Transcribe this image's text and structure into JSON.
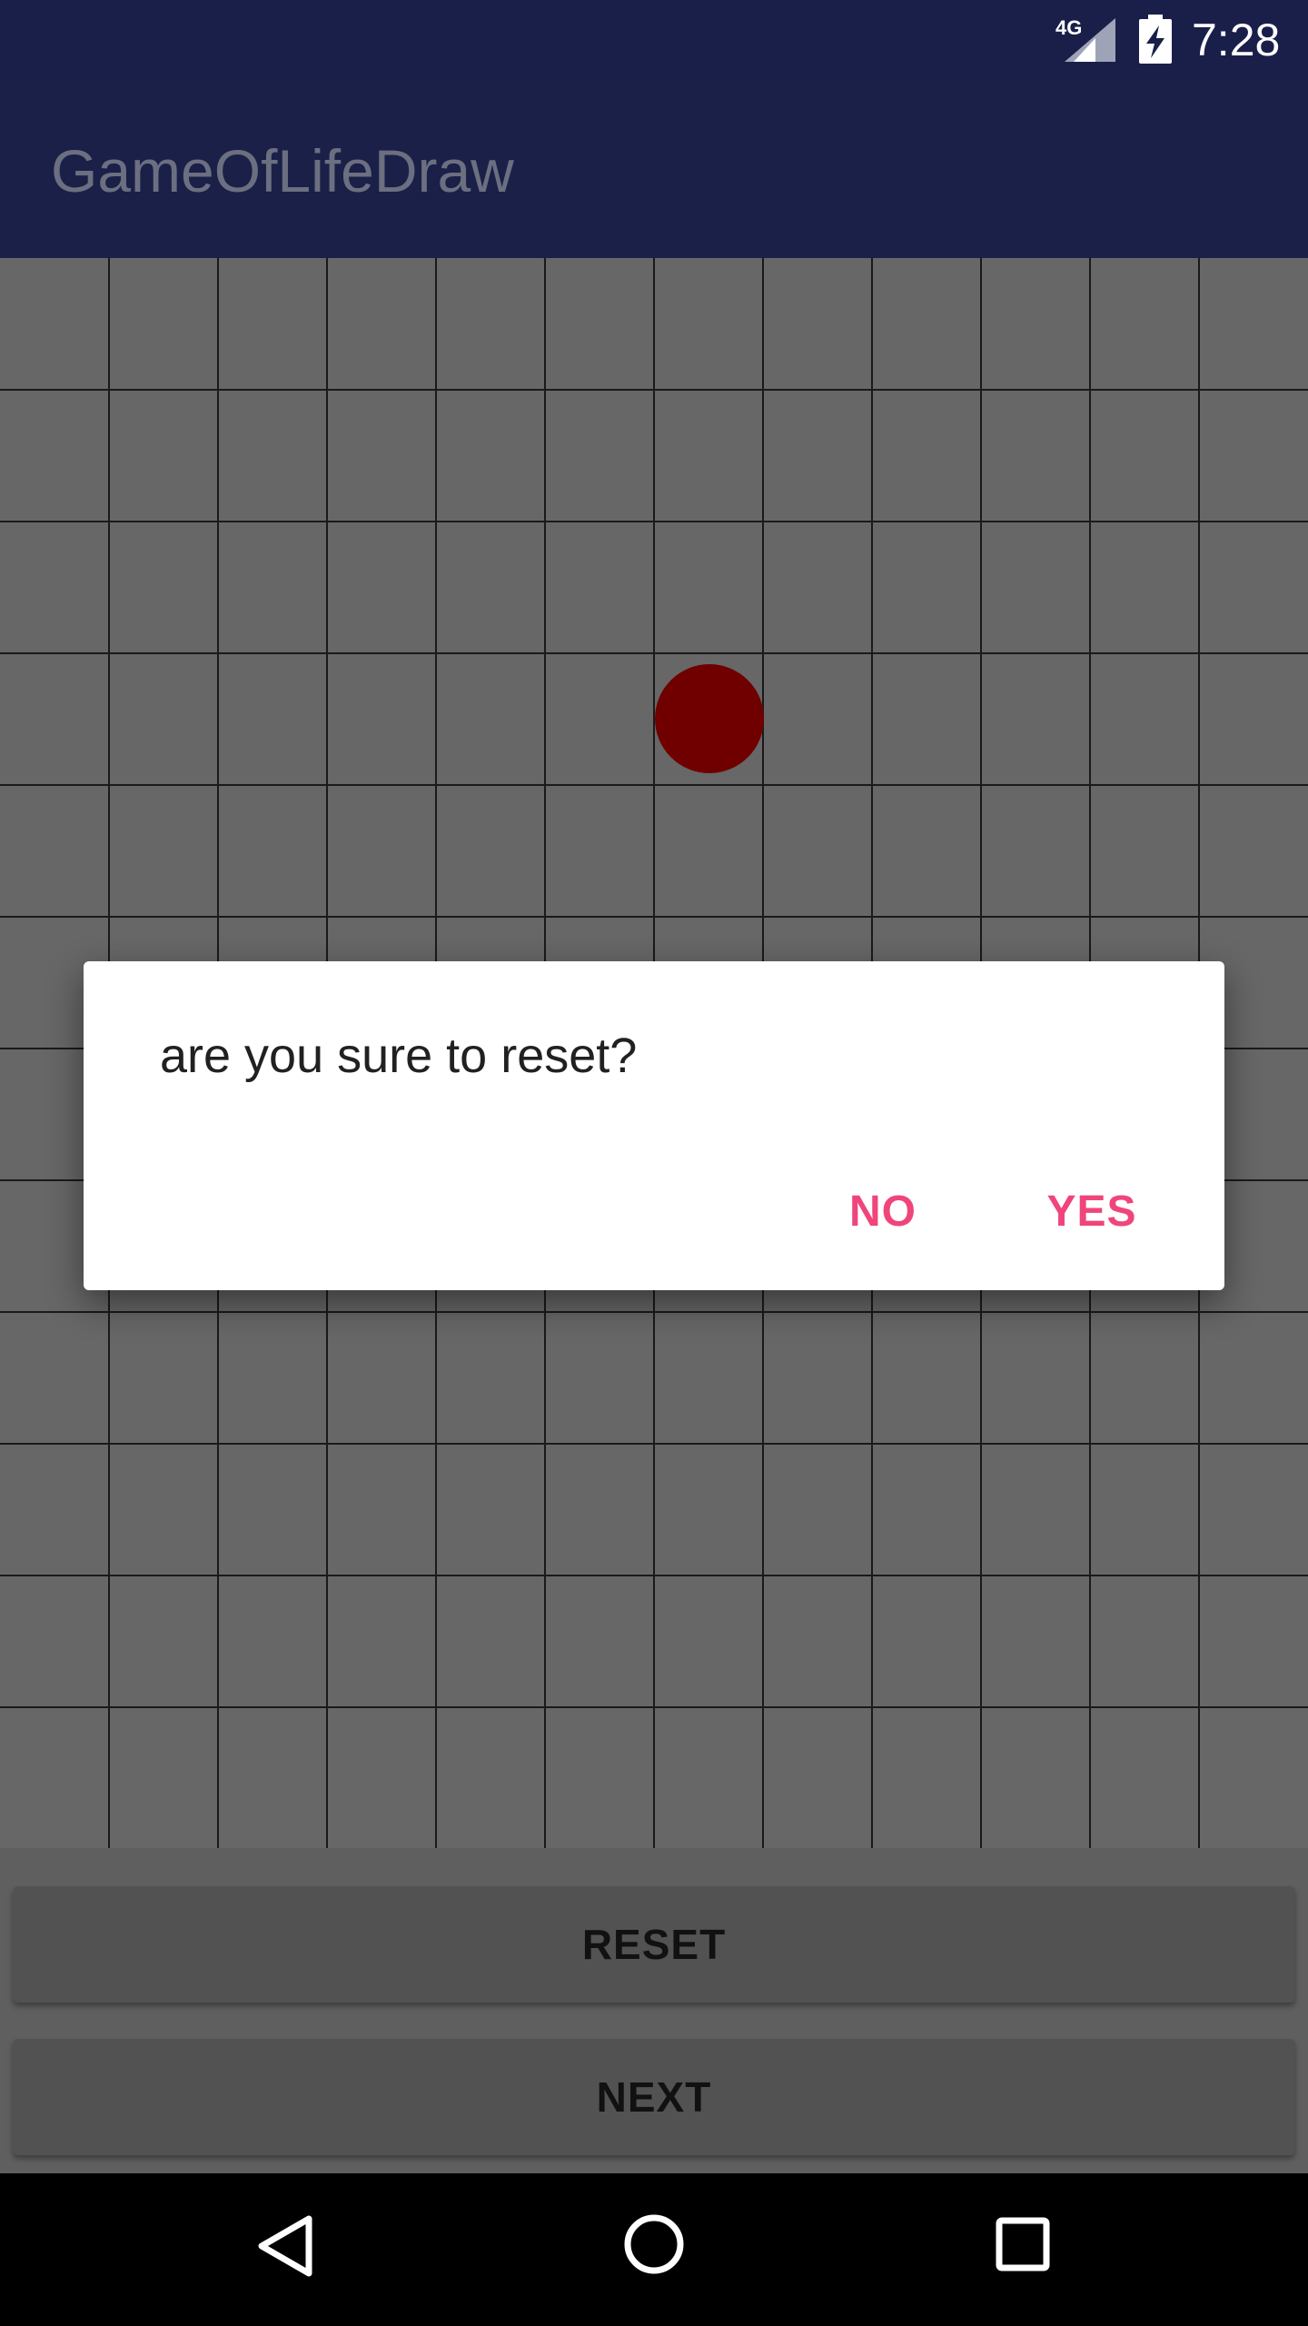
{
  "status_bar": {
    "network": "4G",
    "time": "7:28"
  },
  "app_bar": {
    "title": "GameOfLifeDraw"
  },
  "grid": {
    "columns": 12,
    "rows": 12,
    "background": "#676767",
    "line_color": "#1a1a1a",
    "live_cell_color": "#700000",
    "live_cells": [
      {
        "row": 3,
        "col": 6
      }
    ]
  },
  "buttons": {
    "reset_label": "RESET",
    "next_label": "NEXT"
  },
  "dialog": {
    "message": "are you sure to reset?",
    "no_label": "NO",
    "yes_label": "YES",
    "accent_color": "#f0457b"
  },
  "navigation": {
    "back_icon": "back-triangle-icon",
    "home_icon": "home-circle-icon",
    "recents_icon": "recents-square-icon"
  }
}
